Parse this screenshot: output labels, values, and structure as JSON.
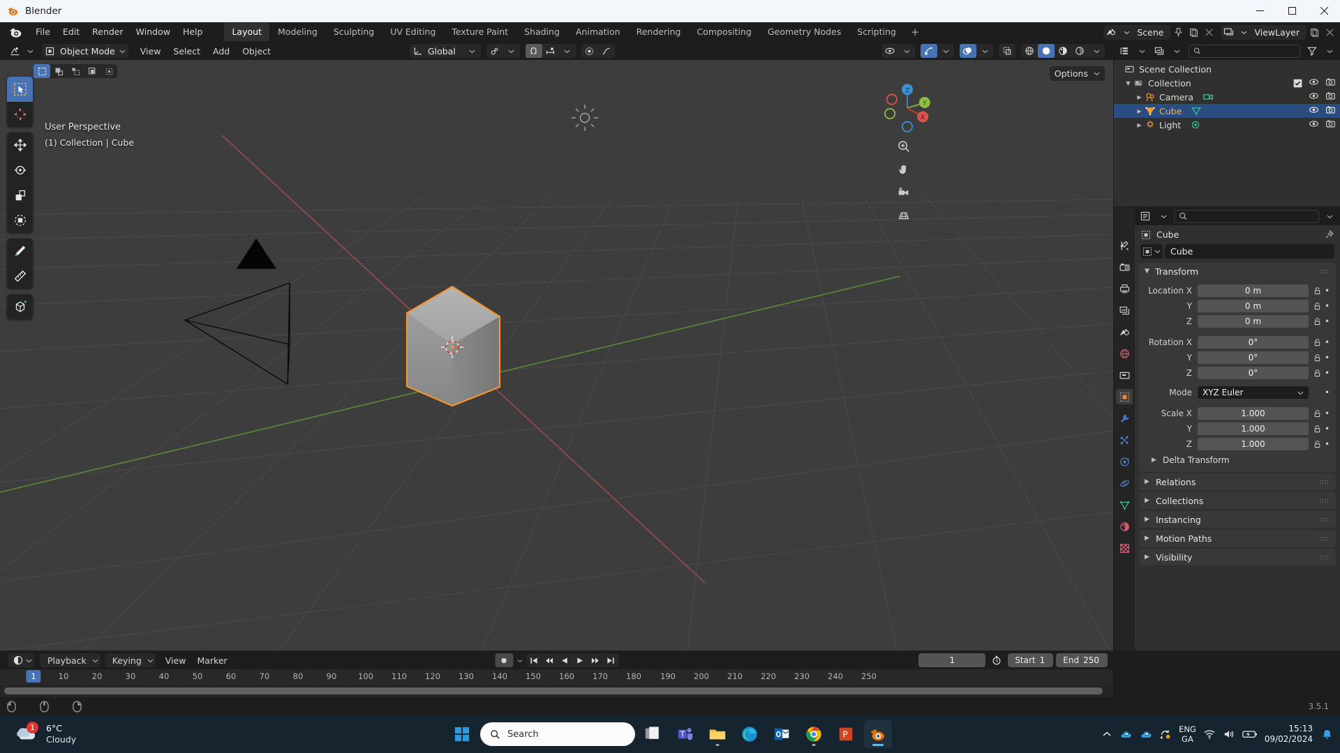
{
  "window": {
    "title": "Blender",
    "minimize": "minimize-icon",
    "maximize": "maximize-icon",
    "close": "close-icon"
  },
  "topbar": {
    "logo": "blender-logo-icon",
    "menus": [
      "File",
      "Edit",
      "Render",
      "Window",
      "Help"
    ],
    "workspaces": [
      {
        "label": "Layout",
        "active": true
      },
      {
        "label": "Modeling",
        "active": false
      },
      {
        "label": "Sculpting",
        "active": false
      },
      {
        "label": "UV Editing",
        "active": false
      },
      {
        "label": "Texture Paint",
        "active": false
      },
      {
        "label": "Shading",
        "active": false
      },
      {
        "label": "Animation",
        "active": false
      },
      {
        "label": "Rendering",
        "active": false
      },
      {
        "label": "Compositing",
        "active": false
      },
      {
        "label": "Geometry Nodes",
        "active": false
      },
      {
        "label": "Scripting",
        "active": false
      }
    ],
    "add_workspace": "+",
    "scene_name": "Scene",
    "viewlayer_name": "ViewLayer"
  },
  "viewport": {
    "header": {
      "mode": "Object Mode",
      "menus": [
        "View",
        "Select",
        "Add",
        "Object"
      ],
      "transform_orientation": "Global",
      "select_modes": [
        "tweak-select-icon",
        "box-select-icon",
        "circle-select-icon",
        "lasso-select-icon",
        "select-extend-icon"
      ],
      "shading_modes": [
        "wireframe-shading-icon",
        "solid-shading-icon",
        "material-preview-icon",
        "rendered-shading-icon"
      ]
    },
    "overlay_line1": "User Perspective",
    "overlay_line2": "(1) Collection | Cube",
    "options_label": "Options",
    "tools": [
      "tweak-tool-icon",
      "cursor-tool-icon",
      "move-tool-icon",
      "rotate-tool-icon",
      "scale-tool-icon",
      "transform-tool-icon",
      "annotate-tool-icon",
      "measure-tool-icon",
      "add-cube-tool-icon"
    ],
    "nav_buttons": [
      "zoom-icon",
      "pan-hand-icon",
      "camera-view-icon",
      "toggle-perspective-icon"
    ],
    "gizmo_axes": [
      "Z",
      "Y",
      "X"
    ]
  },
  "outliner": {
    "display_mode": "view-layer-icon",
    "filter": "filter-icon",
    "search_placeholder": "",
    "rows": [
      {
        "label": "Scene Collection",
        "icon": "scene-collection-icon",
        "depth": 0,
        "selected": false,
        "expandable": false,
        "checkbox": false,
        "eye": false,
        "camera": false,
        "data_icon": null
      },
      {
        "label": "Collection",
        "icon": "collection-icon",
        "depth": 1,
        "selected": false,
        "expandable": true,
        "checkbox": true,
        "eye": true,
        "camera": true,
        "data_icon": null
      },
      {
        "label": "Camera",
        "icon": "camera-object-icon",
        "depth": 2,
        "selected": false,
        "expandable": true,
        "checkbox": false,
        "eye": true,
        "camera": true,
        "data_icon": "camera-data-icon"
      },
      {
        "label": "Cube",
        "icon": "mesh-object-icon",
        "depth": 2,
        "selected": true,
        "expandable": true,
        "checkbox": false,
        "eye": true,
        "camera": true,
        "data_icon": "mesh-data-icon"
      },
      {
        "label": "Light",
        "icon": "light-object-icon",
        "depth": 2,
        "selected": false,
        "expandable": true,
        "checkbox": false,
        "eye": true,
        "camera": true,
        "data_icon": "light-data-icon"
      }
    ]
  },
  "properties": {
    "tabs": [
      {
        "name": "tool-tab",
        "active": false
      },
      {
        "name": "render-tab",
        "active": false
      },
      {
        "name": "output-tab",
        "active": false
      },
      {
        "name": "view-layer-tab",
        "active": false
      },
      {
        "name": "scene-tab",
        "active": false
      },
      {
        "name": "world-tab",
        "active": false
      },
      {
        "name": "collection-tab",
        "active": false
      },
      {
        "name": "object-tab",
        "active": true
      },
      {
        "name": "modifier-tab",
        "active": false
      },
      {
        "name": "particles-tab",
        "active": false
      },
      {
        "name": "physics-tab",
        "active": false
      },
      {
        "name": "constraint-tab",
        "active": false
      },
      {
        "name": "object-data-tab",
        "active": false
      },
      {
        "name": "material-tab",
        "active": false
      },
      {
        "name": "texture-tab",
        "active": false
      }
    ],
    "breadcrumb": "Cube",
    "object_name": "Cube",
    "transform": {
      "title": "Transform",
      "fields": [
        {
          "label": "Location X",
          "value": "0 m"
        },
        {
          "label": "Y",
          "value": "0 m"
        },
        {
          "label": "Z",
          "value": "0 m"
        },
        {
          "label": "Rotation X",
          "value": "0°"
        },
        {
          "label": "Y",
          "value": "0°"
        },
        {
          "label": "Z",
          "value": "0°"
        }
      ],
      "mode_label": "Mode",
      "mode_value": "XYZ Euler",
      "scale": [
        {
          "label": "Scale X",
          "value": "1.000"
        },
        {
          "label": "Y",
          "value": "1.000"
        },
        {
          "label": "Z",
          "value": "1.000"
        }
      ],
      "delta_transform": "Delta Transform"
    },
    "closed_panels": [
      "Relations",
      "Collections",
      "Instancing",
      "Motion Paths",
      "Visibility"
    ]
  },
  "timeline": {
    "editor_icon": "timeline-editor-icon",
    "menus": [
      "Playback",
      "Keying",
      "View",
      "Marker"
    ],
    "playback_dropdown": "Playback",
    "keying_dropdown": "Keying",
    "transport": [
      "jump-to-start-icon",
      "jump-prev-keyframe-icon",
      "play-reverse-icon",
      "play-icon",
      "jump-next-keyframe-icon",
      "jump-to-end-icon"
    ],
    "record_icon": "auto-keying-icon",
    "current_frame": "1",
    "start_label": "Start",
    "start_value": "1",
    "end_label": "End",
    "end_value": "250",
    "ticks": [
      1,
      10,
      20,
      30,
      40,
      50,
      60,
      70,
      80,
      90,
      100,
      110,
      120,
      130,
      140,
      150,
      160,
      170,
      180,
      190,
      200,
      210,
      220,
      230,
      240,
      250
    ],
    "playhead_frame": "1"
  },
  "statusbar": {
    "mouse_hints": [
      "select-mouse-icon",
      "rotate-view-mouse-icon",
      "menu-mouse-icon"
    ],
    "version": "3.5.1"
  },
  "taskbar": {
    "weather_temp": "6°C",
    "weather_desc": "Cloudy",
    "weather_badge": "1",
    "start_button": "windows-start-icon",
    "search_placeholder": "Search",
    "apps": [
      {
        "name": "task-view-icon",
        "running": false,
        "active": false
      },
      {
        "name": "microsoft-teams-icon",
        "running": false,
        "active": false
      },
      {
        "name": "file-explorer-icon",
        "running": true,
        "active": false
      },
      {
        "name": "microsoft-edge-icon",
        "running": false,
        "active": false
      },
      {
        "name": "outlook-icon",
        "running": false,
        "active": false
      },
      {
        "name": "google-chrome-icon",
        "running": true,
        "active": false
      },
      {
        "name": "powerpoint-icon",
        "running": false,
        "active": false
      },
      {
        "name": "blender-taskbar-icon",
        "running": true,
        "active": true
      }
    ],
    "tray": [
      "show-hidden-icons-chevron",
      "onedrive-icon",
      "onedrive-icon-2",
      "sync-icon"
    ],
    "language": {
      "line1": "ENG",
      "line2": "GA"
    },
    "network": "wifi-icon",
    "volume": "speaker-icon",
    "battery": "battery-icon",
    "time": "15:13",
    "date": "09/02/2024",
    "notifications": "bell-icon"
  },
  "colors": {
    "accent_blue": "#4772b3",
    "selected_orange": "#ffaf29",
    "panel_bg": "#303030",
    "header_bg": "#1d1d1d",
    "viewport_bg": "#3d3d3d",
    "taskbar_bg": "#15242e"
  }
}
